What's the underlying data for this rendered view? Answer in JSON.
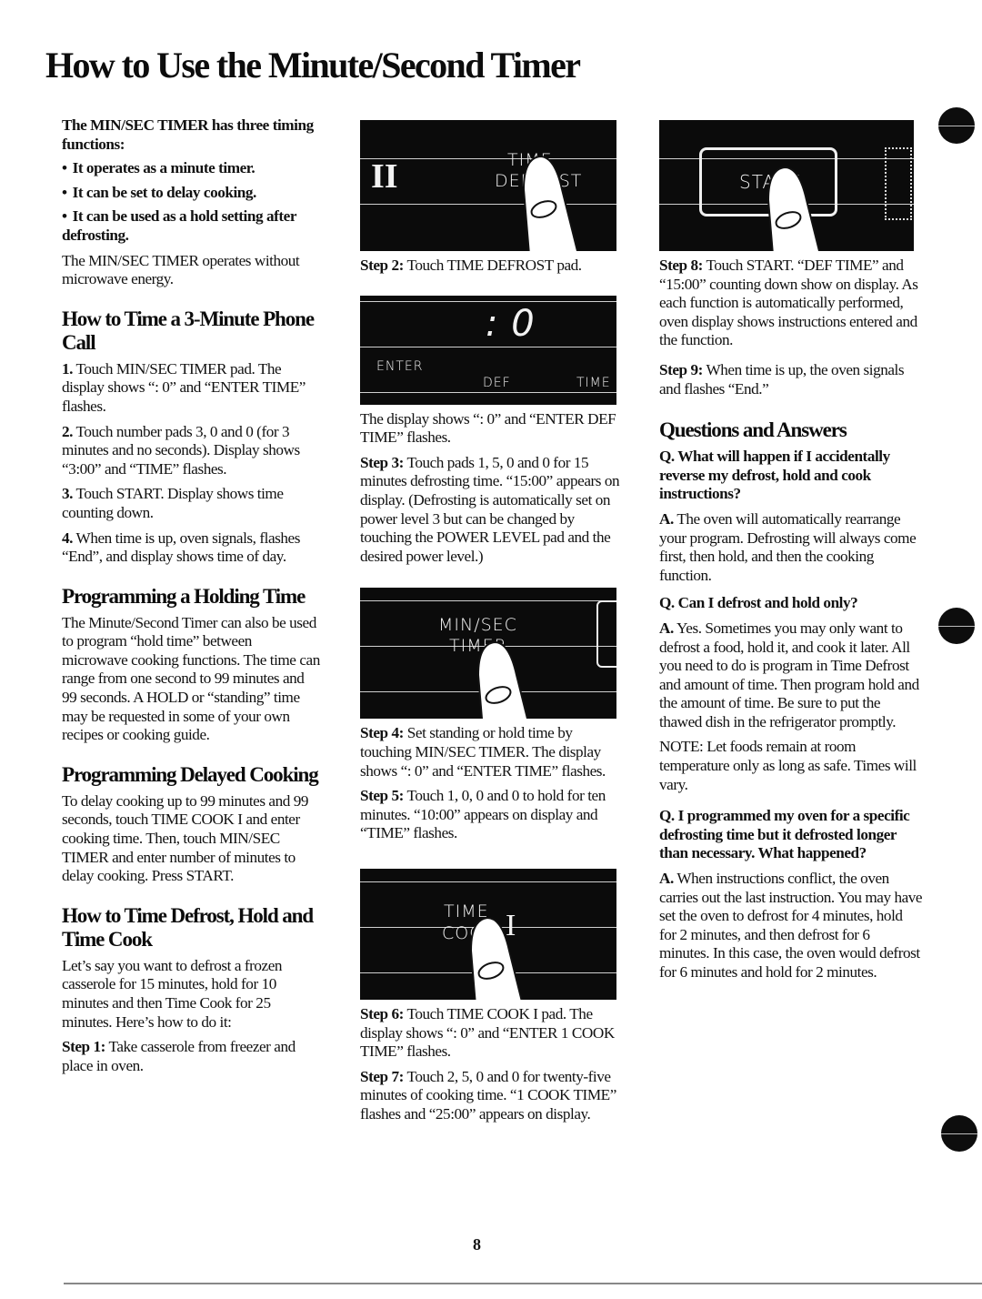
{
  "title": "How to Use the Minute/Second Timer",
  "left": {
    "intro": "The MIN/SEC TIMER has three timing functions:",
    "bullets": [
      "It operates as a minute timer.",
      "It can be set to delay cooking.",
      "It can be used as a hold setting after defrosting."
    ],
    "note": "The MIN/SEC TIMER operates without microwave energy.",
    "phone_call": {
      "heading": "How to Time a 3-Minute Phone Call",
      "steps": [
        {
          "num": "1.",
          "text": "Touch MIN/SEC TIMER pad. The display shows “: 0” and “ENTER TIME” flashes."
        },
        {
          "num": "2.",
          "text": "Touch number pads 3, 0 and 0 (for 3 minutes and no seconds). Display shows “3:00” and “TIME” flashes."
        },
        {
          "num": "3.",
          "text": "Touch START. Display shows time counting down."
        },
        {
          "num": "4.",
          "text": "When time is up, oven signals, flashes “End”, and display shows time of day."
        }
      ]
    },
    "holding": {
      "heading": "Programming a Holding Time",
      "body": "The Minute/Second Timer can also be used to program “hold time” between microwave cooking functions. The time can range from one second to 99 minutes and 99 seconds. A HOLD or “standing” time may be requested in some of your own recipes or cooking guide."
    },
    "delayed": {
      "heading": "Programming Delayed Cooking",
      "body": "To delay cooking up to 99 minutes and 99 seconds, touch TIME COOK I and enter cooking time. Then, touch MIN/SEC TIMER and enter number of minutes to delay cooking. Press START."
    },
    "defrost_hold": {
      "heading": "How to Time Defrost, Hold and Time Cook",
      "body": "Let’s say you want to defrost a frozen casserole for 15 minutes, hold for 10 minutes and then Time Cook for 25 minutes. Here’s how to do it:",
      "step1_label": "Step 1:",
      "step1_text": "Take casserole from freezer and place in oven."
    }
  },
  "middle": {
    "panel_time_defrost": {
      "roman": "II",
      "line1": "TIME",
      "line2": "DEFROST"
    },
    "step2_label": "Step 2:",
    "step2_text": "Touch TIME DEFROST pad.",
    "display_panel": {
      "digit": ": 0",
      "enter": "ENTER",
      "def": "DEF",
      "time": "TIME"
    },
    "display_caption": "The display shows “: 0” and “ENTER DEF TIME” flashes.",
    "step3_label": "Step 3:",
    "step3_text": "Touch pads 1, 5, 0 and 0 for 15 minutes defrosting time. “15:00” appears on display. (Defrosting is automatically set on power level 3 but can be changed by touching the POWER LEVEL pad and the desired power level.)",
    "panel_minsec": {
      "line1": "MIN/SEC",
      "line2": "TIMER"
    },
    "step4_label": "Step 4:",
    "step4_text": "Set standing or hold time by touching MIN/SEC TIMER. The display shows “: 0” and “ENTER TIME” flashes.",
    "step5_label": "Step 5:",
    "step5_text": "Touch 1, 0, 0 and 0 to hold for ten minutes. “10:00” appears on display and “TIME” flashes.",
    "panel_timecook": {
      "line1": "TIME",
      "line2": "COOK",
      "roman": "I"
    },
    "step6_label": "Step 6:",
    "step6_text": "Touch TIME COOK I pad. The display shows “: 0” and “ENTER 1 COOK TIME” flashes.",
    "step7_label": "Step 7:",
    "step7_text": "Touch 2, 5, 0 and 0 for twenty-five minutes of cooking time. “1 COOK TIME” flashes and “25:00” appears on display."
  },
  "right": {
    "panel_start": {
      "label": "START"
    },
    "step8_label": "Step 8:",
    "step8_text": "Touch START. “DEF TIME” and “15:00” counting down show on display. As each function is automatically performed, oven display shows instructions entered and the function.",
    "step9_label": "Step 9:",
    "step9_text": "When time is up, the oven signals and flashes “End.”",
    "qa_heading": "Questions and Answers",
    "qa": [
      {
        "q": "Q. What will happen if I accidentally reverse my defrost, hold and cook instructions?",
        "a_label": "A.",
        "a": "The oven will automatically rearrange your program. Defrosting will always come first, then hold, and then the cooking function."
      },
      {
        "q": "Q. Can I defrost and hold only?",
        "a_label": "A.",
        "a": "Yes. Sometimes you may only want to defrost a food, hold it, and cook it later. All you need to do is program in Time Defrost and amount of time. Then program hold and the amount of time. Be sure to put the thawed dish in the refrigerator promptly.",
        "note": "NOTE: Let foods remain at room temperature only as long as safe. Times will vary."
      },
      {
        "q": "Q. I programmed my oven for a specific defrosting time but it defrosted longer than necessary. What happened?",
        "a_label": "A.",
        "a": "When instructions conflict, the oven carries out the last instruction. You may have set the oven to defrost for 4 minutes, hold for 2 minutes, and then defrost for 6 minutes. In this case, the oven would defrost for 6 minutes and hold for 2 minutes."
      }
    ]
  },
  "page_number": "8"
}
